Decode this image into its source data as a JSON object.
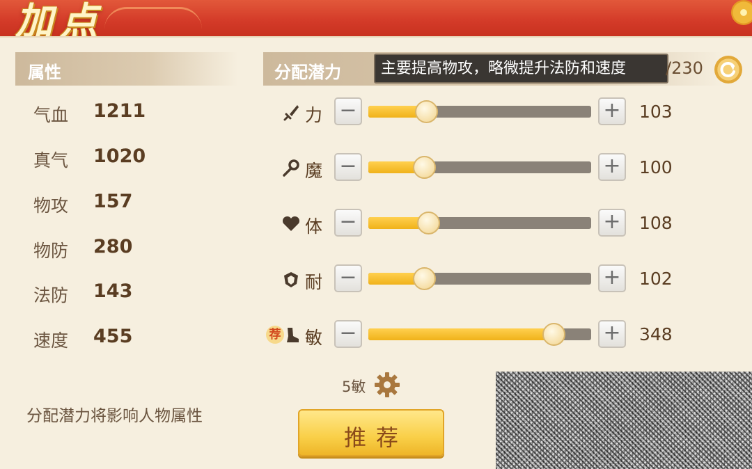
{
  "header": {
    "title": "加点"
  },
  "attributes": {
    "label": "属性",
    "items": [
      {
        "name": "气血",
        "value": "1211"
      },
      {
        "name": "真气",
        "value": "1020"
      },
      {
        "name": "物攻",
        "value": "157"
      },
      {
        "name": "物防",
        "value": "280"
      },
      {
        "name": "法防",
        "value": "143"
      },
      {
        "name": "速度",
        "value": "455"
      }
    ],
    "hint": "分配潜力将影响人物属性"
  },
  "potential": {
    "label": "分配潜力",
    "tooltip": "主要提高物攻，略微提升法防和速度",
    "remaining": "/230",
    "stats": [
      {
        "name": "力",
        "icon": "sword-icon",
        "value": "103",
        "level": 0.26
      },
      {
        "name": "魔",
        "icon": "magic-staff-icon",
        "value": "100",
        "level": 0.25
      },
      {
        "name": "体",
        "icon": "heart-icon",
        "value": "108",
        "level": 0.27
      },
      {
        "name": "耐",
        "icon": "shield-icon",
        "value": "102",
        "level": 0.25
      },
      {
        "name": "敏",
        "icon": "boot-icon",
        "value": "348",
        "level": 0.83,
        "recommended": "荐"
      }
    ],
    "minus_label": "−",
    "plus_label": "+"
  },
  "preset": {
    "label": "5敏",
    "icon": "gear-icon"
  },
  "recommend_button": {
    "label": "推荐"
  },
  "colors": {
    "accent": "#f0b21a",
    "track": "#8a8278",
    "title_bg": "#d33a28",
    "text": "#5a3d22"
  }
}
